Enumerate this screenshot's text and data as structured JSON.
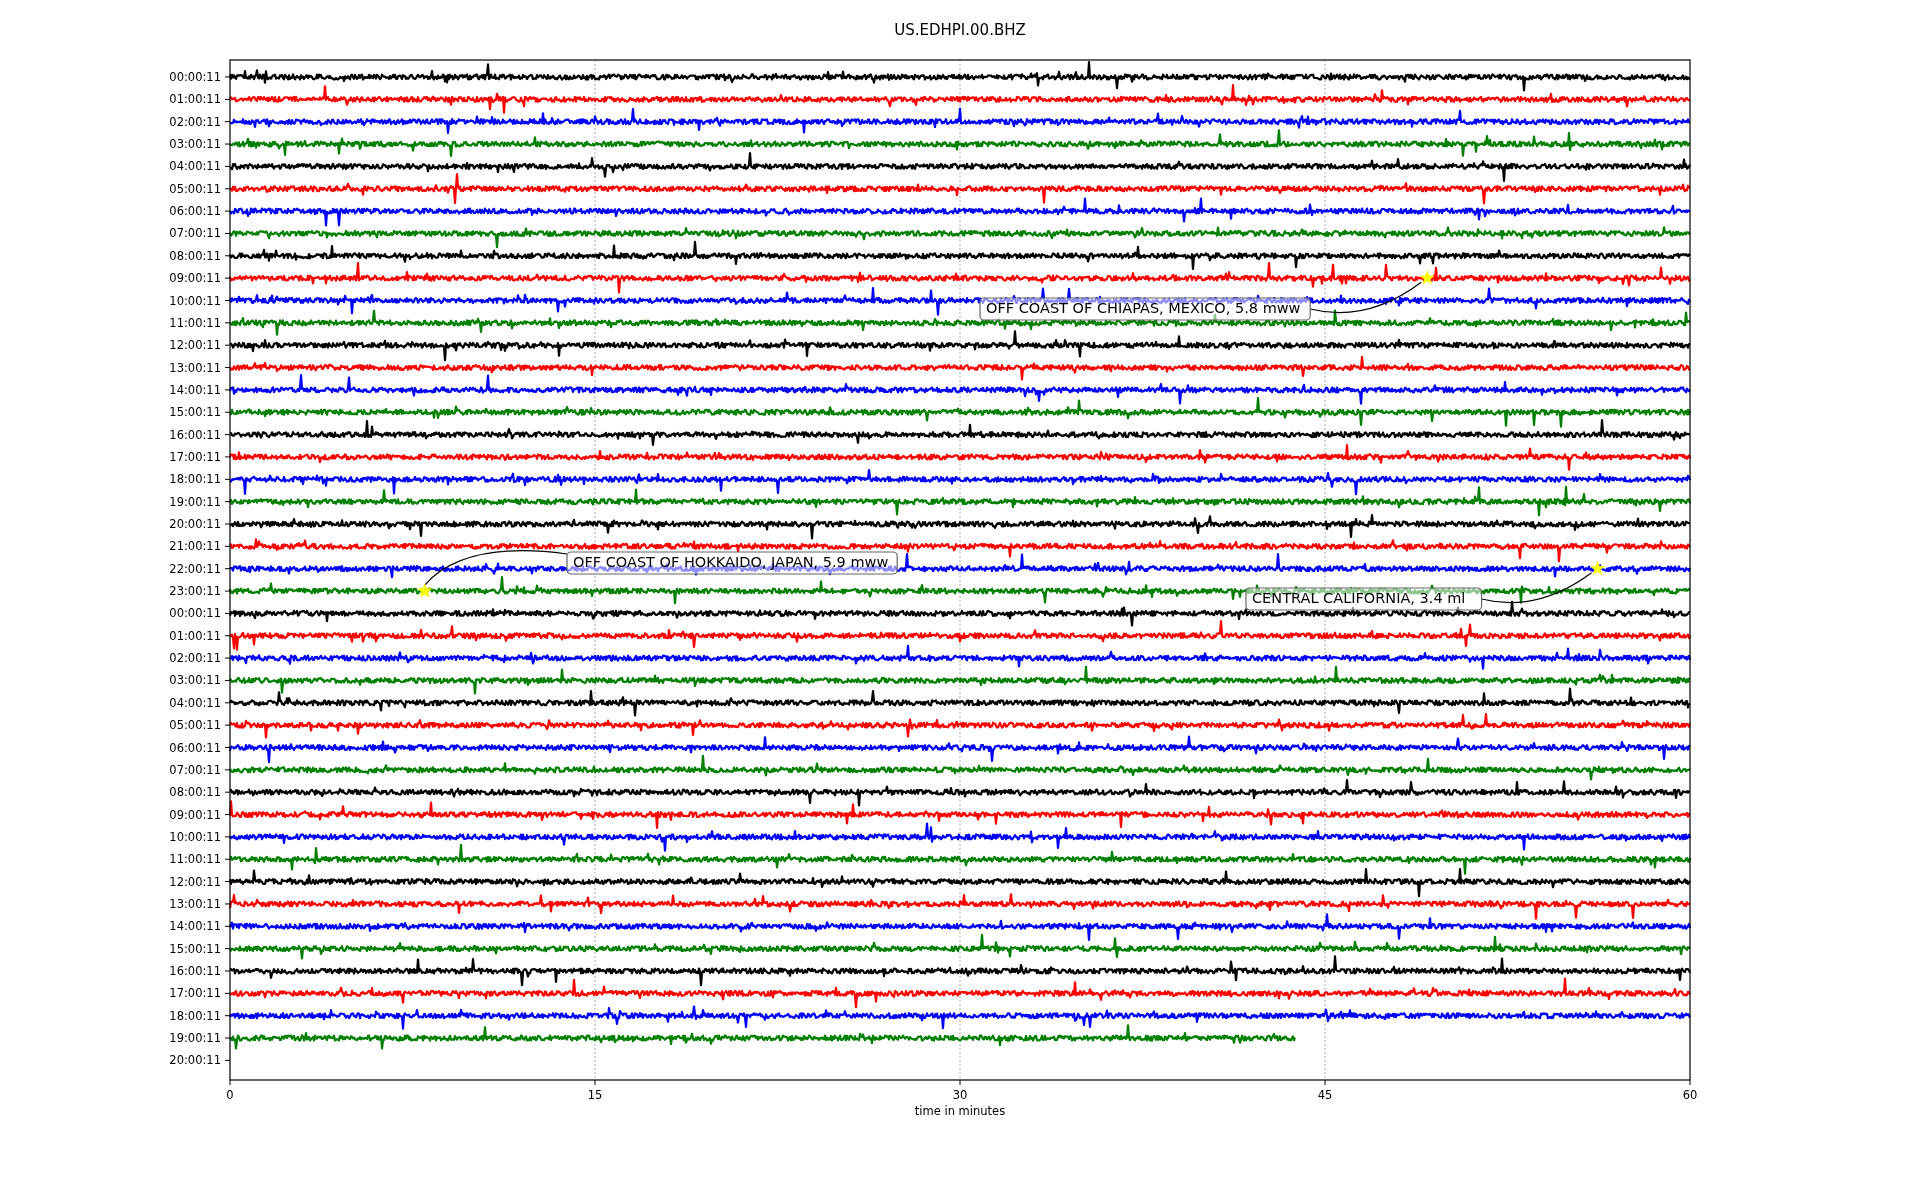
{
  "title": "US.EDHPI.00.BHZ",
  "xlabel": "time in minutes",
  "xticks": [
    "0",
    "15",
    "30",
    "45",
    "60"
  ],
  "traces": [
    {
      "label": "00:00:11",
      "color": "#000000",
      "level": 1
    },
    {
      "label": "01:00:11",
      "color": "#ff0000",
      "level": 1
    },
    {
      "label": "02:00:11",
      "color": "#0000ff",
      "level": 1
    },
    {
      "label": "03:00:11",
      "color": "#008000",
      "level": 1
    },
    {
      "label": "04:00:11",
      "color": "#000000",
      "level": 1
    },
    {
      "label": "05:00:11",
      "color": "#ff0000",
      "level": 1
    },
    {
      "label": "06:00:11",
      "color": "#0000ff",
      "level": 1
    },
    {
      "label": "07:00:11",
      "color": "#008000",
      "level": 1
    },
    {
      "label": "08:00:11",
      "color": "#000000",
      "level": 1
    },
    {
      "label": "09:00:11",
      "color": "#ff0000",
      "level": 1
    },
    {
      "label": "10:00:11",
      "color": "#0000ff",
      "level": 1
    },
    {
      "label": "11:00:11",
      "color": "#008000",
      "level": 1
    },
    {
      "label": "12:00:11",
      "color": "#000000",
      "level": 1
    },
    {
      "label": "13:00:11",
      "color": "#ff0000",
      "level": 1
    },
    {
      "label": "14:00:11",
      "color": "#0000ff",
      "level": 1
    },
    {
      "label": "15:00:11",
      "color": "#008000",
      "level": 1
    },
    {
      "label": "16:00:11",
      "color": "#000000",
      "level": 1
    },
    {
      "label": "17:00:11",
      "color": "#ff0000",
      "level": 1
    },
    {
      "label": "18:00:11",
      "color": "#0000ff",
      "level": 1
    },
    {
      "label": "19:00:11",
      "color": "#008000",
      "level": 1
    },
    {
      "label": "20:00:11",
      "color": "#000000",
      "level": 1
    },
    {
      "label": "21:00:11",
      "color": "#ff0000",
      "level": 1
    },
    {
      "label": "22:00:11",
      "color": "#0000ff",
      "level": 1
    },
    {
      "label": "23:00:11",
      "color": "#008000",
      "level": 1
    },
    {
      "label": "00:00:11",
      "color": "#000000",
      "level": 1
    },
    {
      "label": "01:00:11",
      "color": "#ff0000",
      "level": 1
    },
    {
      "label": "02:00:11",
      "color": "#0000ff",
      "level": 1
    },
    {
      "label": "03:00:11",
      "color": "#008000",
      "level": 1
    },
    {
      "label": "04:00:11",
      "color": "#000000",
      "level": 1
    },
    {
      "label": "05:00:11",
      "color": "#ff0000",
      "level": 1
    },
    {
      "label": "06:00:11",
      "color": "#0000ff",
      "level": 1
    },
    {
      "label": "07:00:11",
      "color": "#008000",
      "level": 1
    },
    {
      "label": "08:00:11",
      "color": "#000000",
      "level": 1
    },
    {
      "label": "09:00:11",
      "color": "#ff0000",
      "level": 1
    },
    {
      "label": "10:00:11",
      "color": "#0000ff",
      "level": 1
    },
    {
      "label": "11:00:11",
      "color": "#008000",
      "level": 1
    },
    {
      "label": "12:00:11",
      "color": "#000000",
      "level": 1
    },
    {
      "label": "13:00:11",
      "color": "#ff0000",
      "level": 1
    },
    {
      "label": "14:00:11",
      "color": "#0000ff",
      "level": 1
    },
    {
      "label": "15:00:11",
      "color": "#008000",
      "level": 1
    },
    {
      "label": "16:00:11",
      "color": "#000000",
      "level": 1
    },
    {
      "label": "17:00:11",
      "color": "#ff0000",
      "level": 1
    },
    {
      "label": "18:00:11",
      "color": "#0000ff",
      "level": 1
    },
    {
      "label": "19:00:11",
      "color": "#008000",
      "level": 0.73
    },
    {
      "label": "20:00:11"
    }
  ],
  "events": [
    {
      "label": "OFF COAST OF CHIAPAS, MEXICO, 5.8 mww"
    },
    {
      "label": "OFF COAST OF HOKKAIDO, JAPAN, 5.9 mww"
    },
    {
      "label": "CENTRAL CALIFORNIA, 3.4 ml"
    }
  ]
}
